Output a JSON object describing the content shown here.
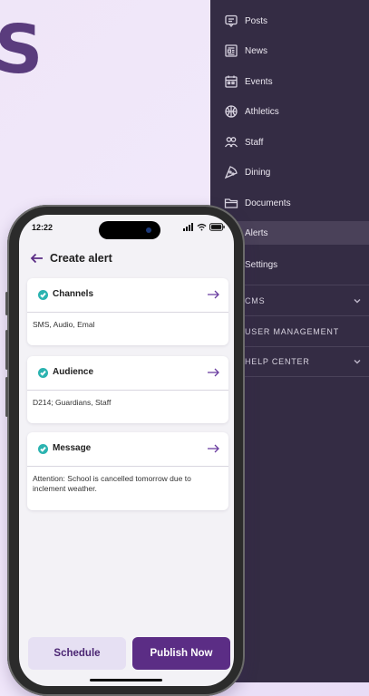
{
  "hero": {
    "letter": "S"
  },
  "sidebar": {
    "items": [
      {
        "label": "Posts",
        "icon": "posts-icon"
      },
      {
        "label": "News",
        "icon": "news-icon"
      },
      {
        "label": "Events",
        "icon": "calendar-icon"
      },
      {
        "label": "Athletics",
        "icon": "ball-icon"
      },
      {
        "label": "Staff",
        "icon": "people-icon"
      },
      {
        "label": "Dining",
        "icon": "pizza-icon"
      },
      {
        "label": "Documents",
        "icon": "folder-icon"
      },
      {
        "label": "Alerts",
        "icon": "alert-icon",
        "active": true
      },
      {
        "label": "Settings",
        "icon": "gear-icon"
      }
    ],
    "sections": [
      {
        "label": "CMS",
        "expandable": true
      },
      {
        "label": "USER MANAGEMENT",
        "expandable": false
      },
      {
        "label": "HELP CENTER",
        "expandable": true
      }
    ]
  },
  "phone": {
    "time": "12:22",
    "title": "Create alert",
    "cards": [
      {
        "title": "Channels",
        "value": "SMS, Audio, Emal"
      },
      {
        "title": "Audience",
        "value": "D214; Guardians, Staff"
      },
      {
        "title": "Message",
        "value": "Attention: School is cancelled tomorrow due to inclement weather."
      }
    ],
    "schedule_label": "Schedule",
    "publish_label": "Publish Now"
  },
  "colors": {
    "accent": "#5b2d85",
    "check": "#2bb3b0",
    "sidebar_bg": "#342c44"
  }
}
